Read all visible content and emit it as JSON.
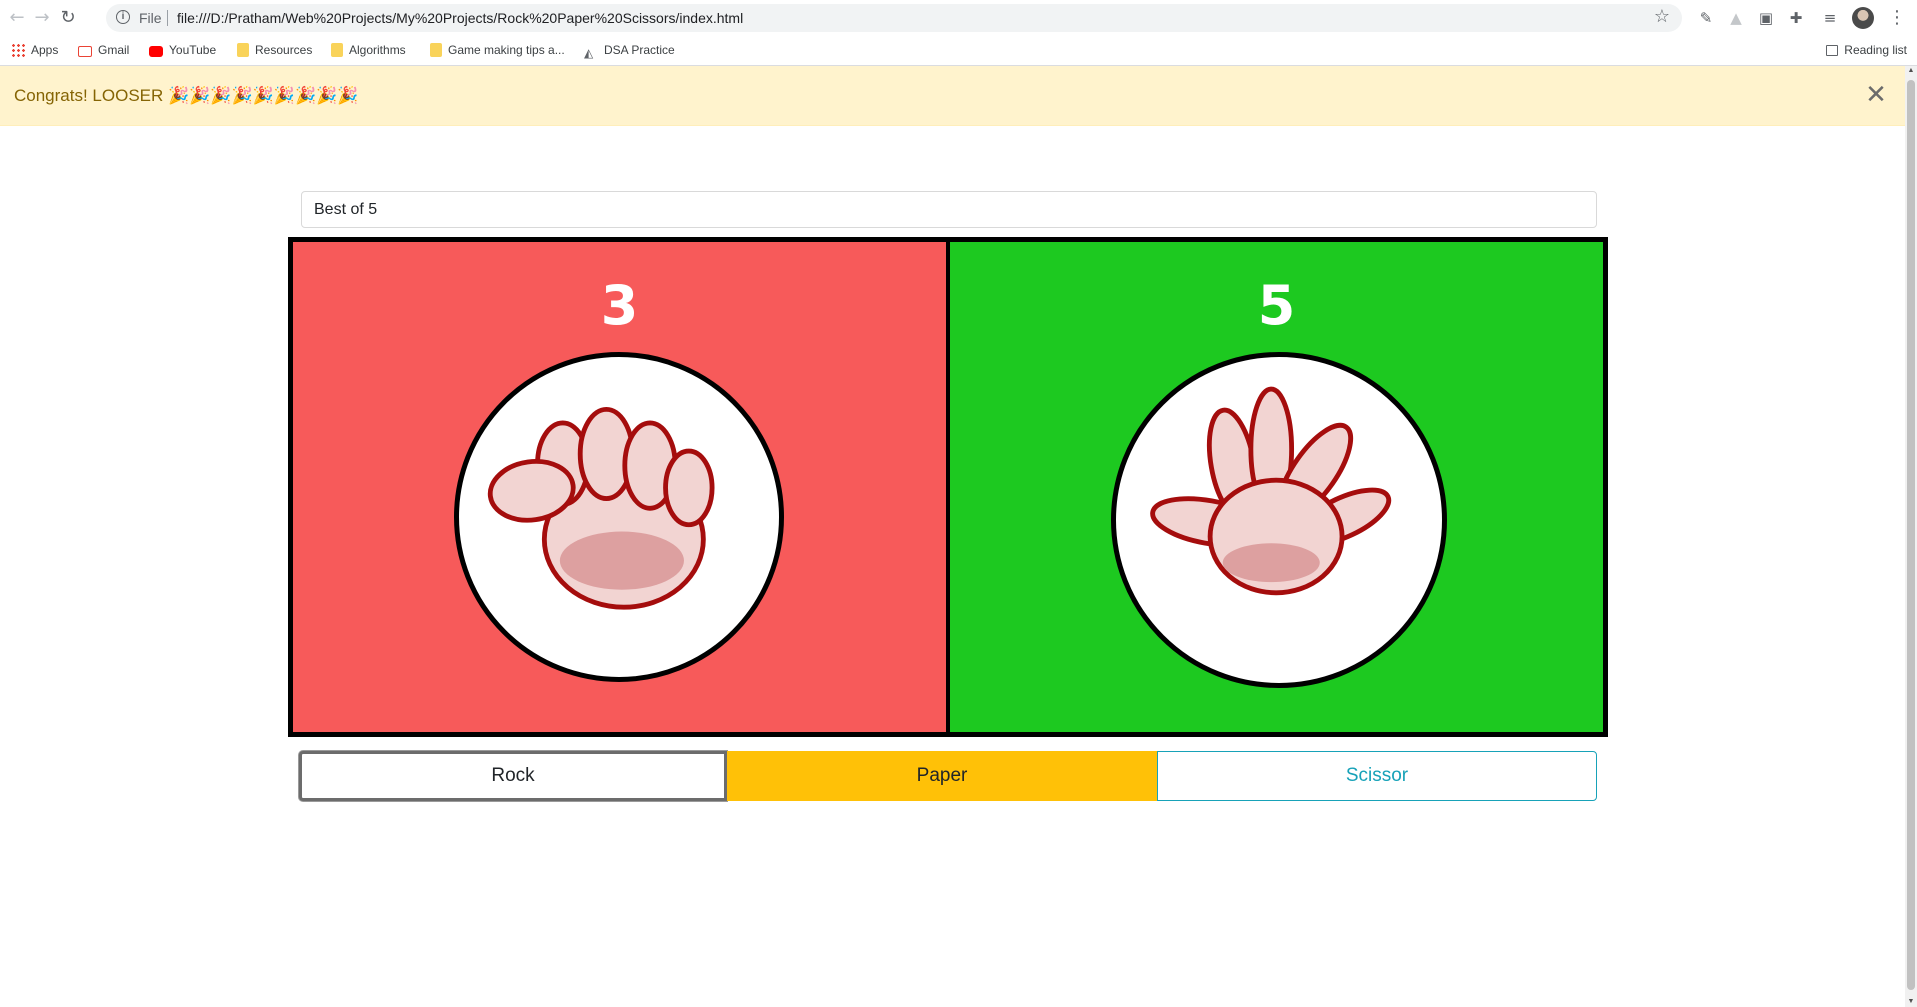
{
  "browser": {
    "scheme_label": "File",
    "url": "file:///D:/Pratham/Web%20Projects/My%20Projects/Rock%20Paper%20Scissors/index.html",
    "bookmarks": [
      {
        "label": "Apps",
        "icon": "apps-grid-icon"
      },
      {
        "label": "Gmail",
        "icon": "gmail-icon"
      },
      {
        "label": "YouTube",
        "icon": "youtube-icon"
      },
      {
        "label": "Resources",
        "icon": "folder-icon"
      },
      {
        "label": "Algorithms",
        "icon": "folder-icon"
      },
      {
        "label": "Game making tips a...",
        "icon": "folder-icon"
      },
      {
        "label": "DSA Practice",
        "icon": "chart-icon"
      }
    ],
    "reading_list": "Reading list"
  },
  "alert": {
    "message": "Congrats! LOOSER",
    "emoji": "🎉🎉🎉🎉🎉🎉🎉🎉🎉",
    "close_glyph": "✕",
    "color": "#856404",
    "background": "#fff3cd"
  },
  "game": {
    "best_of": "Best of 5",
    "player": {
      "score": "3",
      "hand": "rock",
      "color": "#f75a5a"
    },
    "computer": {
      "score": "5",
      "hand": "paper",
      "color": "#1dc920"
    },
    "choices": {
      "rock": "Rock",
      "paper": "Paper",
      "scissor": "Scissor"
    },
    "selected": "paper",
    "accent_colors": {
      "paper": "#ffc107",
      "scissor": "#17a2b8"
    }
  }
}
